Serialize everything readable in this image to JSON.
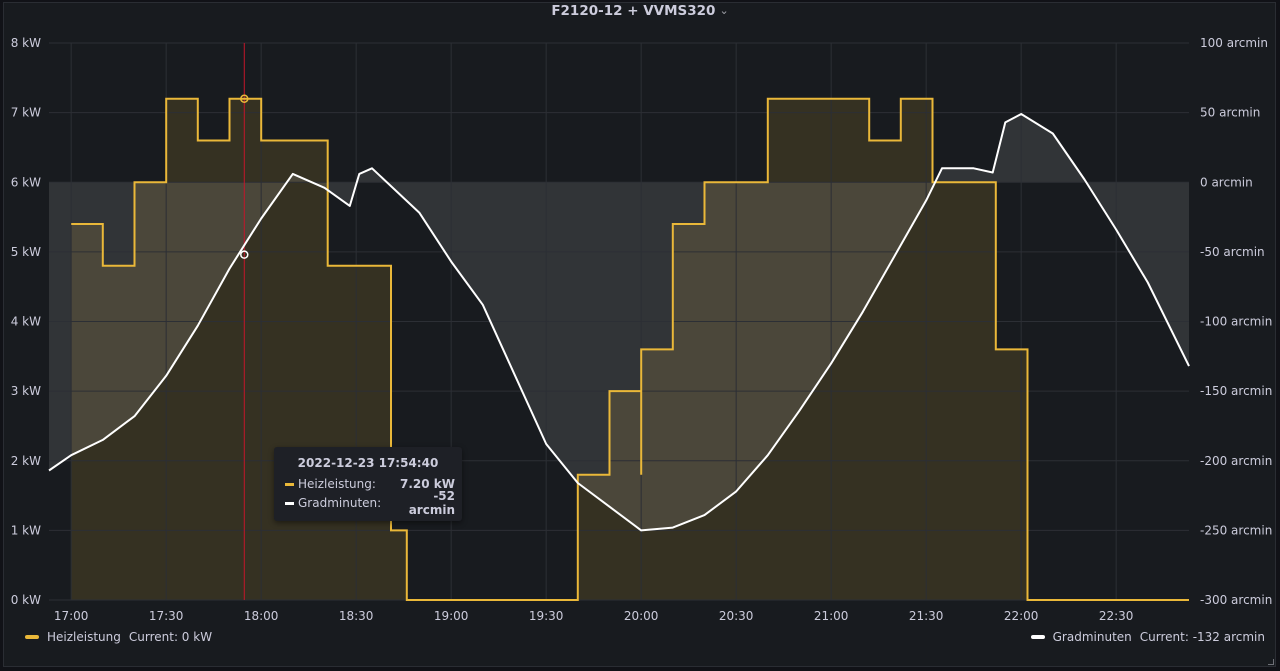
{
  "panel": {
    "title": "F2120-12 + VVMS320",
    "title_menu_icon": "chevron-down-icon"
  },
  "chart_data": {
    "type": "line",
    "x_tick_labels": [
      "17:00",
      "17:30",
      "18:00",
      "18:30",
      "19:00",
      "19:30",
      "20:00",
      "20:30",
      "21:00",
      "21:30",
      "22:00",
      "22:30"
    ],
    "x_range": [
      "16:53",
      "22:53"
    ],
    "y_left": {
      "unit": "kW",
      "range": [
        0,
        8
      ],
      "tick_labels": [
        "0 kW",
        "1 kW",
        "2 kW",
        "3 kW",
        "4 kW",
        "5 kW",
        "6 kW",
        "7 kW",
        "8 kW"
      ]
    },
    "y_right": {
      "unit": "arcmin",
      "range": [
        -300,
        100
      ],
      "tick_labels": [
        "-300 arcmin",
        "-250 arcmin",
        "-200 arcmin",
        "-150 arcmin",
        "-100 arcmin",
        "-50 arcmin",
        "0 arcmin",
        "50 arcmin",
        "100 arcmin"
      ]
    },
    "grid": true,
    "series": [
      {
        "name": "Heizleistung",
        "axis": "left",
        "color": "#eab839",
        "style": "step",
        "legend_current": "Current: 0 kW",
        "points": [
          [
            "17:00",
            5.4
          ],
          [
            "17:10",
            4.8
          ],
          [
            "17:20",
            6.0
          ],
          [
            "17:30",
            7.2
          ],
          [
            "17:40",
            6.6
          ],
          [
            "17:50",
            7.2
          ],
          [
            "18:00",
            6.6
          ],
          [
            "18:21",
            4.8
          ],
          [
            "18:41",
            1.0
          ],
          [
            "18:46",
            0.0
          ],
          [
            "20:00",
            1.8
          ],
          [
            "19:40",
            1.8
          ],
          [
            "19:50",
            3.0
          ],
          [
            "20:00",
            3.6
          ],
          [
            "20:10",
            5.4
          ],
          [
            "20:20",
            6.0
          ],
          [
            "20:40",
            7.2
          ],
          [
            "21:12",
            6.6
          ],
          [
            "21:22",
            7.2
          ],
          [
            "21:32",
            6.0
          ],
          [
            "21:52",
            3.6
          ],
          [
            "22:02",
            0.0
          ],
          [
            "22:53",
            0.0
          ]
        ]
      },
      {
        "name": "Gradminuten",
        "axis": "right",
        "color": "#ffffff",
        "style": "line",
        "legend_current": "Current: -132 arcmin",
        "points": [
          [
            "16:53",
            -207
          ],
          [
            "17:00",
            -196
          ],
          [
            "17:10",
            -185
          ],
          [
            "17:20",
            -168
          ],
          [
            "17:30",
            -139
          ],
          [
            "17:40",
            -103
          ],
          [
            "17:50",
            -62
          ],
          [
            "18:00",
            -26
          ],
          [
            "18:10",
            6
          ],
          [
            "18:20",
            -4
          ],
          [
            "18:28",
            -17
          ],
          [
            "18:31",
            6
          ],
          [
            "18:35",
            10
          ],
          [
            "18:50",
            -22
          ],
          [
            "19:00",
            -57
          ],
          [
            "19:10",
            -88
          ],
          [
            "19:20",
            -138
          ],
          [
            "19:30",
            -188
          ],
          [
            "19:40",
            -216
          ],
          [
            "19:50",
            -233
          ],
          [
            "20:00",
            -250
          ],
          [
            "20:10",
            -248
          ],
          [
            "20:20",
            -239
          ],
          [
            "20:30",
            -222
          ],
          [
            "20:40",
            -196
          ],
          [
            "20:50",
            -164
          ],
          [
            "21:00",
            -130
          ],
          [
            "21:10",
            -93
          ],
          [
            "21:20",
            -53
          ],
          [
            "21:30",
            -13
          ],
          [
            "21:35",
            10
          ],
          [
            "21:45",
            10
          ],
          [
            "21:51",
            7
          ],
          [
            "21:55",
            43
          ],
          [
            "22:00",
            49
          ],
          [
            "22:10",
            35
          ],
          [
            "22:20",
            2
          ],
          [
            "22:30",
            -34
          ],
          [
            "22:40",
            -72
          ],
          [
            "22:53",
            -132
          ]
        ]
      }
    ],
    "cursor_time": "17:54:40",
    "threshold_right_axis": 0
  },
  "tooltip": {
    "title": "2022-12-23 17:54:40",
    "rows": [
      {
        "label": "Heizleistung:",
        "value": "7.20 kW",
        "color": "#eab839"
      },
      {
        "label": "Gradminuten:",
        "value": "-52 arcmin",
        "color": "#ffffff"
      }
    ]
  },
  "legend": [
    {
      "name": "Heizleistung",
      "current": "Current: 0 kW",
      "color": "#eab839"
    },
    {
      "name": "Gradminuten",
      "current": "Current: -132 arcmin",
      "color": "#ffffff"
    }
  ],
  "colors": {
    "background": "#181b1f",
    "grid": "#2c2f35",
    "text": "#ccccdc",
    "cursor": "#c4162a"
  }
}
